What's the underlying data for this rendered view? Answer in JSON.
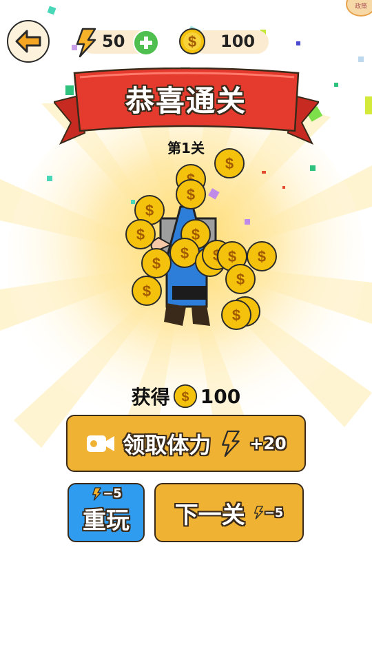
{
  "hud": {
    "energy_value": "50",
    "coins_value": "100",
    "policy_badge": "政策"
  },
  "banner": {
    "title": "恭喜通关",
    "level": "第1关"
  },
  "reward": {
    "label": "获得",
    "amount": "100"
  },
  "buttons": {
    "claim_energy": "领取体力",
    "claim_energy_bonus": "+20",
    "replay": "重玩",
    "replay_cost": "−5",
    "next_level": "下一关",
    "next_level_cost": "−5"
  },
  "colors": {
    "accent_orange": "#f0b233",
    "ribbon_red": "#e53a2e",
    "replay_blue": "#2f9cf0",
    "coin_gold": "#f4c20d"
  },
  "icons": {
    "back": "arrow-left-icon",
    "energy": "lightning-icon",
    "add": "plus-icon",
    "coin": "dollar-coin-icon",
    "video": "video-camera-icon"
  }
}
